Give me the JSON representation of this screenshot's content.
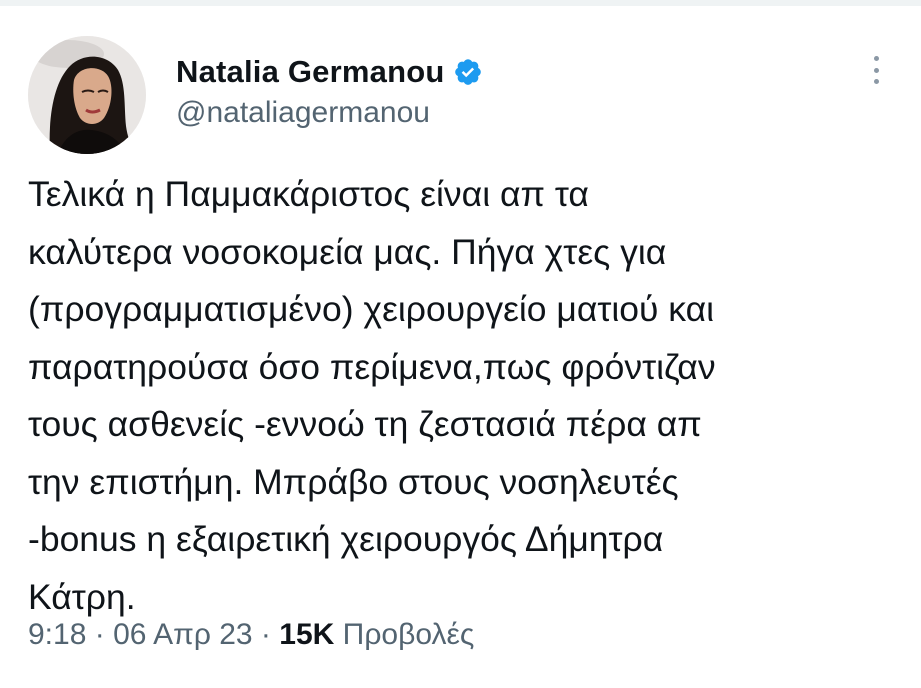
{
  "author": {
    "display_name": "Natalia Germanou",
    "handle": "@nataliagermanou",
    "verified": true
  },
  "icons": {
    "verified": "verified-badge-icon",
    "more": "more-options-icon",
    "avatar": "profile-photo"
  },
  "colors": {
    "verified_blue": "#1d9bf0",
    "secondary_text": "#536471",
    "primary_text": "#0f1419"
  },
  "tweet": {
    "lines": [
      "Τελικά η Παμμακάριστος είναι απ τα",
      "καλύτερα νοσοκομεία μας. Πήγα χτες για",
      "(προγραμματισμένο) χειρουργείο ματιού και",
      "παρατηρούσα όσο περίμενα,πως φρόντιζαν",
      "τους ασθενείς -εννοώ τη ζεστασιά πέρα απ",
      "την επιστήμη. Μπράβο στους νοσηλευτές",
      "-bonus η εξαιρετική χειρουργός Δήμητρα",
      "Κάτρη."
    ]
  },
  "meta": {
    "time": "9:18",
    "separator": " · ",
    "date": "06 Απρ 23",
    "views_count": "15K",
    "views_label": "Προβολές"
  }
}
